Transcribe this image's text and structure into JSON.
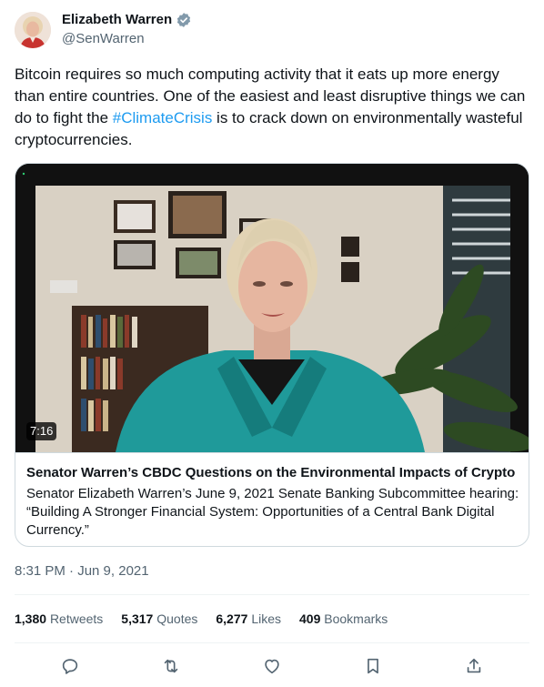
{
  "author": {
    "display_name": "Elizabeth Warren",
    "handle": "@SenWarren"
  },
  "tweet": {
    "text_before": "Bitcoin requires so much computing activity that it eats up more energy than entire countries. One of the easiest and least disruptive things we can do to fight the ",
    "hashtag": "#ClimateCrisis",
    "text_after": " is to crack down on environmentally wasteful cryptocurrencies."
  },
  "card": {
    "duration": "7:16",
    "title": "Senator Warren’s CBDC Questions on the Environmental Impacts of Crypto",
    "description": "Senator Elizabeth Warren’s June 9, 2021 Senate Banking Subcommittee hearing: “Building A Stronger Financial System: Opportunities of a Central Bank Digital Currency.”"
  },
  "timestamp": "8:31 PM · Jun 9, 2021",
  "stats": [
    {
      "num": "1,380",
      "label": "Retweets"
    },
    {
      "num": "5,317",
      "label": "Quotes"
    },
    {
      "num": "6,277",
      "label": "Likes"
    },
    {
      "num": "409",
      "label": "Bookmarks"
    }
  ],
  "colors": {
    "accent": "#1d9bf0",
    "secondary_text": "#536471",
    "border": "#cfd9de"
  },
  "icons": [
    "verified-badge-icon",
    "reply-icon",
    "retweet-icon",
    "like-icon",
    "bookmark-icon",
    "share-icon"
  ]
}
